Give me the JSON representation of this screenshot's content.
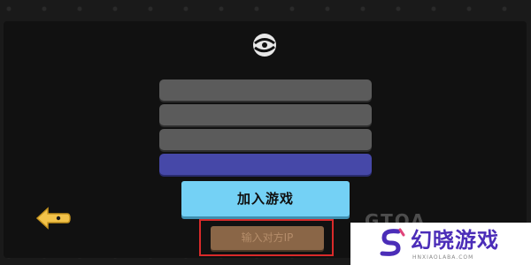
{
  "colors": {
    "background": "#1a1a1a",
    "panel": "#111111",
    "input_field": "#5b5b5b",
    "name_field": "#4648a8",
    "join_button": "#74d1f5",
    "ip_button": "#8a6647",
    "highlight": "#d92a2a",
    "watermark_brand": "#4b2db8"
  },
  "icons": {
    "logo": "swirl-logo-icon",
    "back": "yellow-back-arrow-icon",
    "watermark_logo": "s-brand-icon"
  },
  "menu": {
    "join_label": "加入游戏",
    "ip_label": "输入对方IP"
  },
  "watermark": {
    "faint_text": "GTOA",
    "title": "幻晓游戏",
    "url": "HNXIAOLABA.COM"
  }
}
